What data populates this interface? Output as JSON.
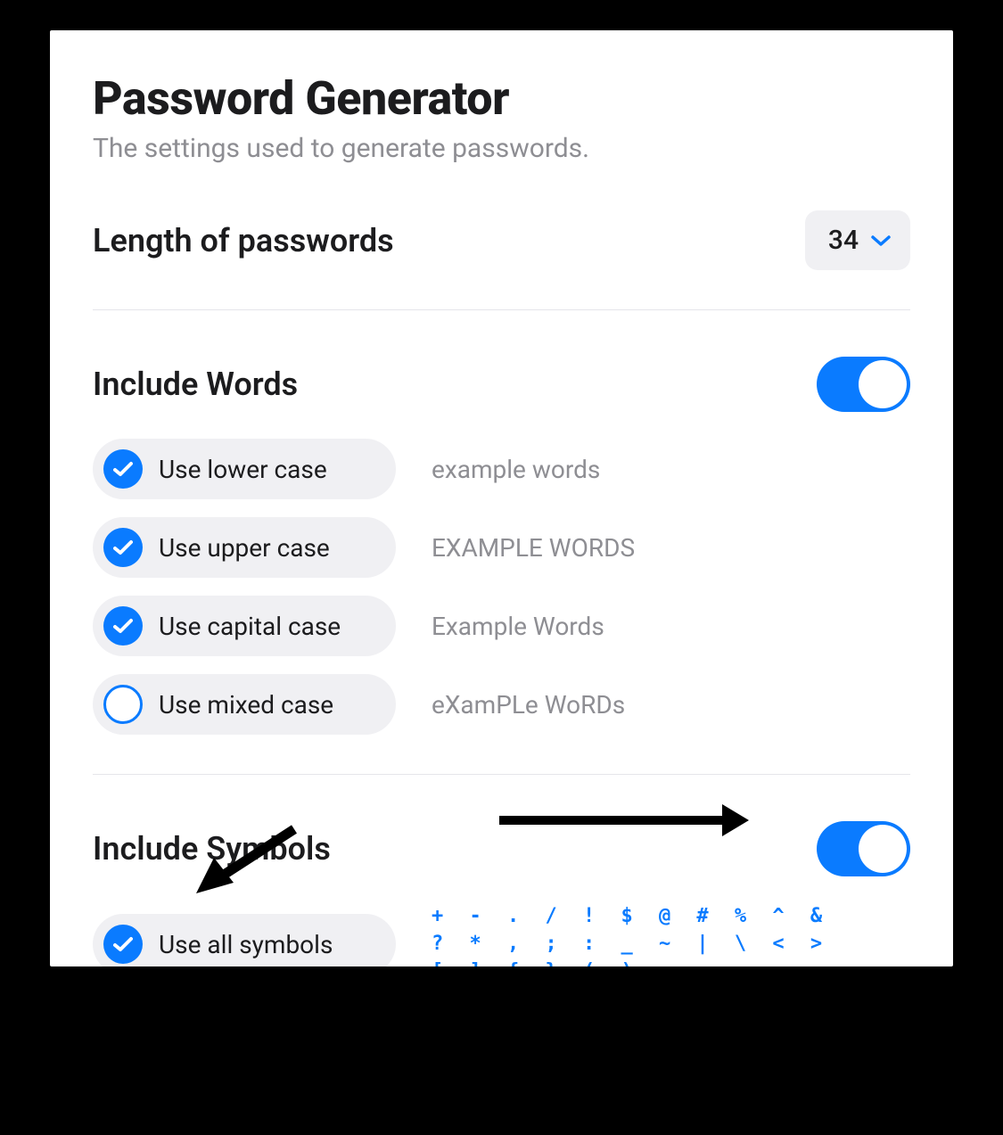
{
  "header": {
    "title": "Password Generator",
    "subtitle": "The settings used to generate passwords."
  },
  "length": {
    "label": "Length of passwords",
    "value": "34"
  },
  "includeWords": {
    "label": "Include Words",
    "toggle": true,
    "options": [
      {
        "label": "Use lower case",
        "checked": true,
        "example": "example words"
      },
      {
        "label": "Use upper case",
        "checked": true,
        "example": "EXAMPLE WORDS"
      },
      {
        "label": "Use capital case",
        "checked": true,
        "example": "Example Words"
      },
      {
        "label": "Use mixed case",
        "checked": false,
        "example": "eXamPLe WoRDs"
      }
    ]
  },
  "includeSymbols": {
    "label": "Include Symbols",
    "toggle": true,
    "options": [
      {
        "label": "Use all symbols",
        "checked": true,
        "example": "+ - . / ! $ @ # % ^ & ? * , ; : _ ~ | \\ < > [ ] { } ( )"
      }
    ]
  },
  "colors": {
    "accent": "#0a7bff",
    "muted": "#8e8e93",
    "chip": "#f0f0f3",
    "divider": "#e5e5ea"
  }
}
